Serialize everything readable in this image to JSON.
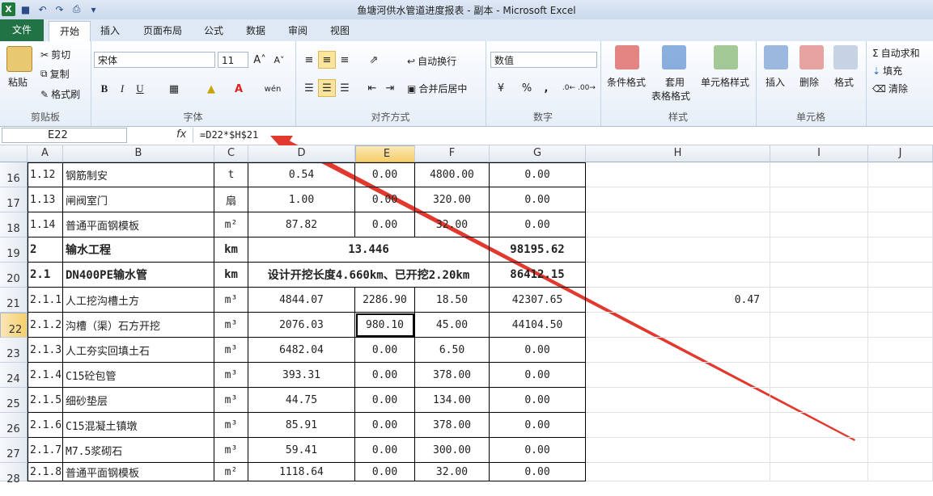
{
  "window": {
    "title": "鱼塘河供水管道进度报表 - 副本 - Microsoft Excel"
  },
  "ribbon_tabs": [
    "文件",
    "开始",
    "插入",
    "页面布局",
    "公式",
    "数据",
    "审阅",
    "视图"
  ],
  "clipboard": {
    "paste": "粘贴",
    "cut": "剪切",
    "copy": "复制",
    "format_painter": "格式刷",
    "label": "剪贴板"
  },
  "font": {
    "name": "宋体",
    "size": "11",
    "bold": "B",
    "italic": "I",
    "underline": "U",
    "label": "字体"
  },
  "alignment": {
    "wrap": "自动换行",
    "merge": "合并后居中",
    "label": "对齐方式"
  },
  "number": {
    "format": "数值",
    "percent": "%",
    "comma": ",",
    "label": "数字"
  },
  "styles": {
    "conditional": "条件格式",
    "table_fmt_1": "套用",
    "table_fmt_2": "表格格式",
    "cell_styles": "单元格样式",
    "label": "样式"
  },
  "cells": {
    "insert": "插入",
    "delete": "删除",
    "format": "格式",
    "label": "单元格"
  },
  "editing": {
    "autosum": "自动求和",
    "fill": "填充",
    "clear": "清除"
  },
  "formula_bar": {
    "name_box": "E22",
    "fx": "fx",
    "formula": "=D22*$H$21"
  },
  "columns": [
    "A",
    "B",
    "C",
    "D",
    "E",
    "F",
    "G",
    "H",
    "I",
    "J"
  ],
  "rows": [
    {
      "num": "16",
      "a": "1.12",
      "b": "钢筋制安",
      "c": "t",
      "d": "0.54",
      "e": "0.00",
      "f": "4800.00",
      "g": "0.00"
    },
    {
      "num": "17",
      "a": "1.13",
      "b": "闸阀室门",
      "c": "扇",
      "d": "1.00",
      "e": "0.00",
      "f": "320.00",
      "g": "0.00"
    },
    {
      "num": "18",
      "a": "1.14",
      "b": "普通平面钢模板",
      "c": "m²",
      "d": "87.82",
      "e": "0.00",
      "f": "32.00",
      "g": "0.00"
    },
    {
      "num": "19",
      "a": "2",
      "b": "输水工程",
      "c": "km",
      "merged": "13.446",
      "g": "98195.62"
    },
    {
      "num": "20",
      "a": "2.1",
      "b": "DN400PE输水管",
      "c": "km",
      "merged": "设计开挖长度4.660km、已开挖2.20km",
      "g": "86412.15"
    },
    {
      "num": "21",
      "a": "2.1.1",
      "b": "人工挖沟槽土方",
      "c": "m³",
      "d": "4844.07",
      "e": "2286.90",
      "f": "18.50",
      "g": "42307.65",
      "h": "0.47"
    },
    {
      "num": "22",
      "a": "2.1.2",
      "b": "沟槽（渠）石方开挖",
      "c": "m³",
      "d": "2076.03",
      "e": "980.10",
      "f": "45.00",
      "g": "44104.50"
    },
    {
      "num": "23",
      "a": "2.1.3",
      "b": "人工夯实回填土石",
      "c": "m³",
      "d": "6482.04",
      "e": "0.00",
      "f": "6.50",
      "g": "0.00"
    },
    {
      "num": "24",
      "a": "2.1.4",
      "b": "C15砼包管",
      "c": "m³",
      "d": "393.31",
      "e": "0.00",
      "f": "378.00",
      "g": "0.00"
    },
    {
      "num": "25",
      "a": "2.1.5",
      "b": "细砂垫层",
      "c": "m³",
      "d": "44.75",
      "e": "0.00",
      "f": "134.00",
      "g": "0.00"
    },
    {
      "num": "26",
      "a": "2.1.6",
      "b": "C15混凝土镇墩",
      "c": "m³",
      "d": "85.91",
      "e": "0.00",
      "f": "378.00",
      "g": "0.00"
    },
    {
      "num": "27",
      "a": "2.1.7",
      "b": "M7.5浆砌石",
      "c": "m³",
      "d": "59.41",
      "e": "0.00",
      "f": "300.00",
      "g": "0.00"
    },
    {
      "num": "28",
      "a": "2.1.8",
      "b": "普通平面钢模板",
      "c": "m²",
      "d": "1118.64",
      "e": "0.00",
      "f": "32.00",
      "g": "0.00"
    }
  ],
  "colors": {
    "accent": "#217346",
    "selection": "#f5cf6b",
    "arrow": "#e2392f"
  }
}
